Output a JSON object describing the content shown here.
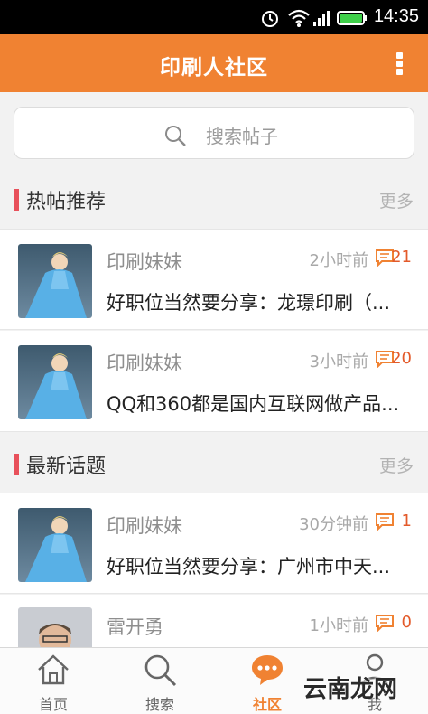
{
  "status_bar": {
    "time": "14:35"
  },
  "header": {
    "title": "印刷人社区",
    "menu_icon": "more-vertical-icon"
  },
  "search": {
    "placeholder": "搜索帖子"
  },
  "hot_section": {
    "title": "热帖推荐",
    "more_label": "更多",
    "posts": [
      {
        "author": "印刷妹妹",
        "time": "2小时前",
        "comments": "21",
        "title": "好职位当然要分享：龙璟印刷（..."
      },
      {
        "author": "印刷妹妹",
        "time": "3小时前",
        "comments": "20",
        "title": "QQ和360都是国内互联网做产品..."
      }
    ]
  },
  "latest_section": {
    "title": "最新话题",
    "more_label": "更多",
    "posts": [
      {
        "author": "印刷妹妹",
        "time": "30分钟前",
        "comments": "1",
        "title": "好职位当然要分享：广州市中天..."
      },
      {
        "author": "雷开勇",
        "time": "1小时前",
        "comments": "0",
        "title": ""
      }
    ]
  },
  "tabs": [
    {
      "label": "首页",
      "icon": "home-icon"
    },
    {
      "label": "搜索",
      "icon": "search-icon"
    },
    {
      "label": "社区",
      "icon": "community-chat-icon",
      "active": true
    },
    {
      "label": "我",
      "icon": "profile-icon"
    }
  ],
  "watermark": "云南龙网",
  "colors": {
    "accent": "#f08232",
    "section_bar": "#e8515b",
    "comment": "#e35a2a"
  }
}
